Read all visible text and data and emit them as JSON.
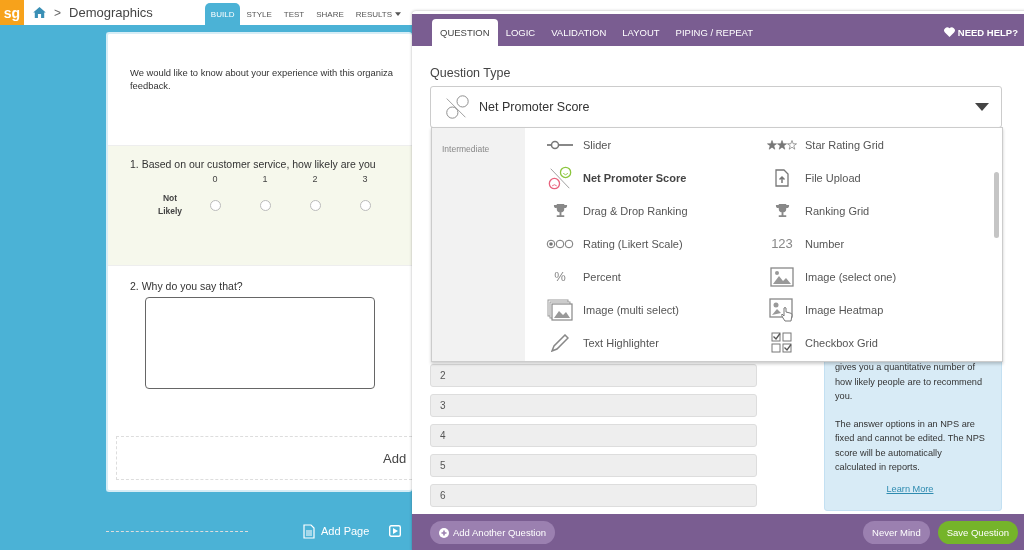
{
  "app": {
    "logo": "sg",
    "separator": ">",
    "survey_title": "Demographics"
  },
  "nav_tabs": [
    {
      "label": "BUILD",
      "selected": true,
      "has_menu": false
    },
    {
      "label": "STYLE",
      "selected": false,
      "has_menu": false
    },
    {
      "label": "TEST",
      "selected": false,
      "has_menu": false
    },
    {
      "label": "SHARE",
      "selected": false,
      "has_menu": false
    },
    {
      "label": "RESULTS",
      "selected": false,
      "has_menu": true
    }
  ],
  "survey": {
    "intro_lines": [
      "We would like to know about your experience with this organiza",
      "feedback."
    ],
    "questions": [
      {
        "kind": "nps",
        "title": "1. Based on our customer service, how likely are you",
        "low_label": "Not Likely",
        "scale": [
          {
            "label": "0",
            "selected": false
          },
          {
            "label": "1",
            "selected": false
          },
          {
            "label": "2",
            "selected": false
          },
          {
            "label": "3",
            "selected": false
          }
        ]
      },
      {
        "kind": "essay",
        "title": "2. Why do you say that?"
      }
    ],
    "add_label": "Add"
  },
  "page_footer": {
    "add_page": "Add Page"
  },
  "editor": {
    "tabs": [
      {
        "label": "QUESTION",
        "selected": true
      },
      {
        "label": "LOGIC",
        "selected": false
      },
      {
        "label": "VALIDATION",
        "selected": false
      },
      {
        "label": "LAYOUT",
        "selected": false
      },
      {
        "label": "PIPING / REPEAT",
        "selected": false
      }
    ],
    "help": "NEED HELP?",
    "type_label": "Question Type",
    "selected_type": "Net Promoter Score",
    "menu": {
      "category": "Intermediate",
      "items": [
        {
          "label": "Slider",
          "kind": "slider",
          "selected": false
        },
        {
          "label": "Star Rating Grid",
          "kind": "stars",
          "selected": false
        },
        {
          "label": "Net Promoter Score",
          "kind": "nps",
          "selected": true
        },
        {
          "label": "File Upload",
          "kind": "upload",
          "selected": false
        },
        {
          "label": "Drag & Drop Ranking",
          "kind": "trophy",
          "selected": false
        },
        {
          "label": "Ranking Grid",
          "kind": "trophy",
          "selected": false
        },
        {
          "label": "Rating (Likert Scale)",
          "kind": "likert",
          "selected": false
        },
        {
          "label": "Number",
          "kind": "glyph",
          "glyph": "123",
          "selected": false
        },
        {
          "label": "Percent",
          "kind": "glyph",
          "glyph": "%",
          "selected": false
        },
        {
          "label": "Image (select one)",
          "kind": "image",
          "selected": false
        },
        {
          "label": "Image (multi select)",
          "kind": "images",
          "selected": false
        },
        {
          "label": "Image Heatmap",
          "kind": "heatmap",
          "selected": false
        },
        {
          "label": "Text Highlighter",
          "kind": "highlighter",
          "selected": false
        },
        {
          "label": "Checkbox Grid",
          "kind": "checkgrid",
          "selected": false
        }
      ]
    },
    "answers": [
      "2",
      "3",
      "4",
      "5",
      "6"
    ],
    "info": [
      "gives you a quantitative number of how likely people are to recommend you.",
      "The answer options in an NPS are fixed and cannot be edited. The NPS score will be automatically calculated in reports."
    ],
    "learn_more": "Learn More",
    "buttons": [
      {
        "label": "Add Another Question",
        "kind": "add"
      },
      {
        "label": "Never Mind",
        "kind": "cancel"
      },
      {
        "label": "Save Question",
        "kind": "primary"
      }
    ]
  }
}
